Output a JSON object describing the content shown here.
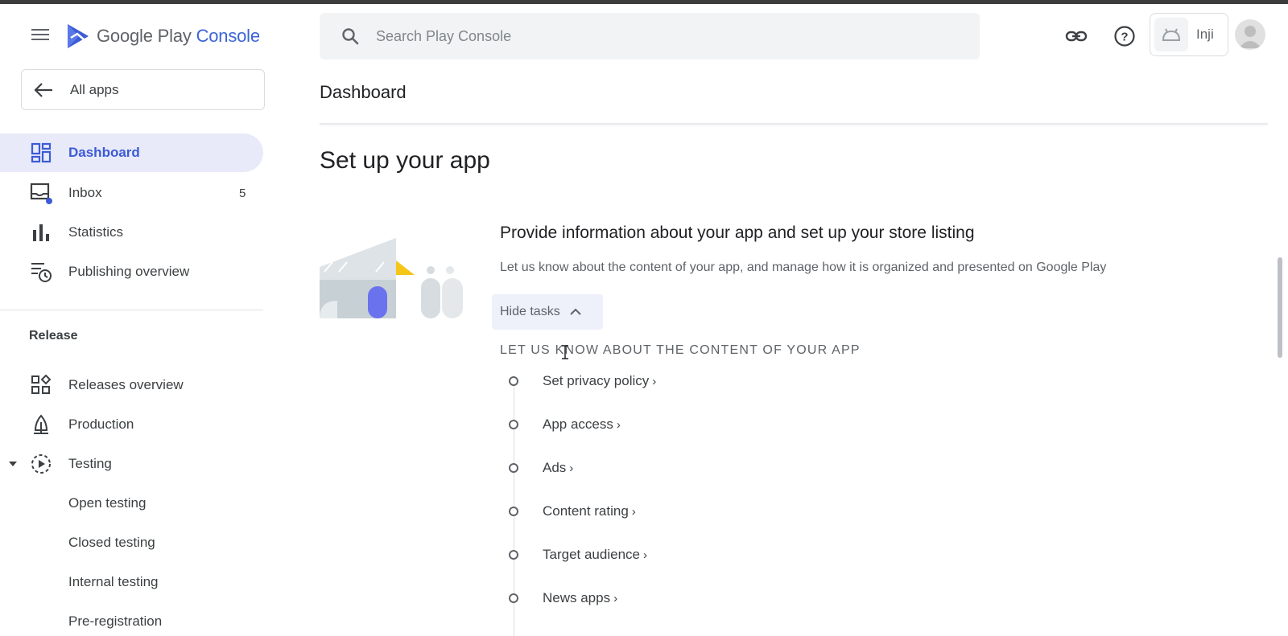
{
  "header": {
    "logo_text_a": "Google Play",
    "logo_text_b": "Console",
    "search_placeholder": "Search Play Console",
    "developer_name": "Inji"
  },
  "sidebar": {
    "all_apps_label": "All apps",
    "items": [
      {
        "label": "Dashboard",
        "icon": "dashboard-icon",
        "active": true
      },
      {
        "label": "Inbox",
        "icon": "inbox-icon",
        "count": "5"
      },
      {
        "label": "Statistics",
        "icon": "bar-chart-icon"
      },
      {
        "label": "Publishing overview",
        "icon": "publishing-overview-icon"
      }
    ],
    "release_section_title": "Release",
    "release_items": [
      {
        "label": "Releases overview",
        "icon": "releases-overview-icon"
      },
      {
        "label": "Production",
        "icon": "production-icon"
      },
      {
        "label": "Testing",
        "icon": "testing-icon",
        "expanded": true
      },
      {
        "label": "Open testing"
      },
      {
        "label": "Closed testing"
      },
      {
        "label": "Internal testing"
      },
      {
        "label": "Pre-registration"
      }
    ]
  },
  "main": {
    "page_title": "Dashboard",
    "setup_title": "Set up your app",
    "card": {
      "title": "Provide information about your app and set up your store listing",
      "description": "Let us know about the content of your app, and manage how it is organized and presented on Google Play",
      "hide_tasks_label": "Hide tasks",
      "tasks_heading": "LET US KNOW ABOUT THE CONTENT OF YOUR APP",
      "tasks": [
        {
          "label": "Set privacy policy"
        },
        {
          "label": "App access"
        },
        {
          "label": "Ads"
        },
        {
          "label": "Content rating"
        },
        {
          "label": "Target audience"
        },
        {
          "label": "News apps"
        }
      ]
    }
  },
  "colors": {
    "accent": "#3c5bd6",
    "active_bg": "#e8eafa",
    "inbox_dot": "#3c5bd6"
  }
}
